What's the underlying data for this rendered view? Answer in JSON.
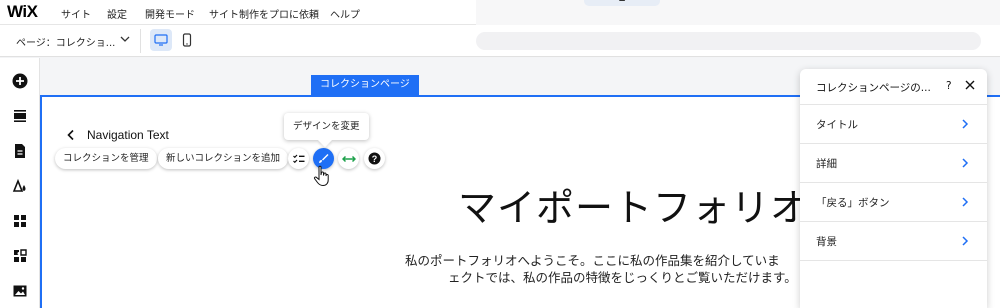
{
  "app": {
    "logo": "WiX",
    "menu": [
      "サイト",
      "設定",
      "開発モード",
      "サイト制作をプロに依頼",
      "ヘルプ"
    ]
  },
  "toolbar": {
    "page_select": "ページ：コレクショ..."
  },
  "canvas": {
    "section_tag": "コレクションページ",
    "nav_text": "Navigation Text",
    "buttons": {
      "manage": "コレクションを管理",
      "add": "新しいコレクションを追加"
    },
    "tooltip": "デザインを変更",
    "title": "マイポートフォリオ",
    "desc_line1": "私のポートフォリオへようこそ。ここに私の作品集を紹介していま",
    "desc_line2": "ェクトでは、私の作品の特徴をじっくりとご覧いただけます。"
  },
  "panel": {
    "title": "コレクションページの...",
    "help": "?",
    "rows": [
      "タイトル",
      "詳細",
      "「戻る」ボタン",
      "背景"
    ]
  },
  "colors": {
    "accent": "#1f6ff5",
    "panel_chevron": "#1f6ff5"
  }
}
